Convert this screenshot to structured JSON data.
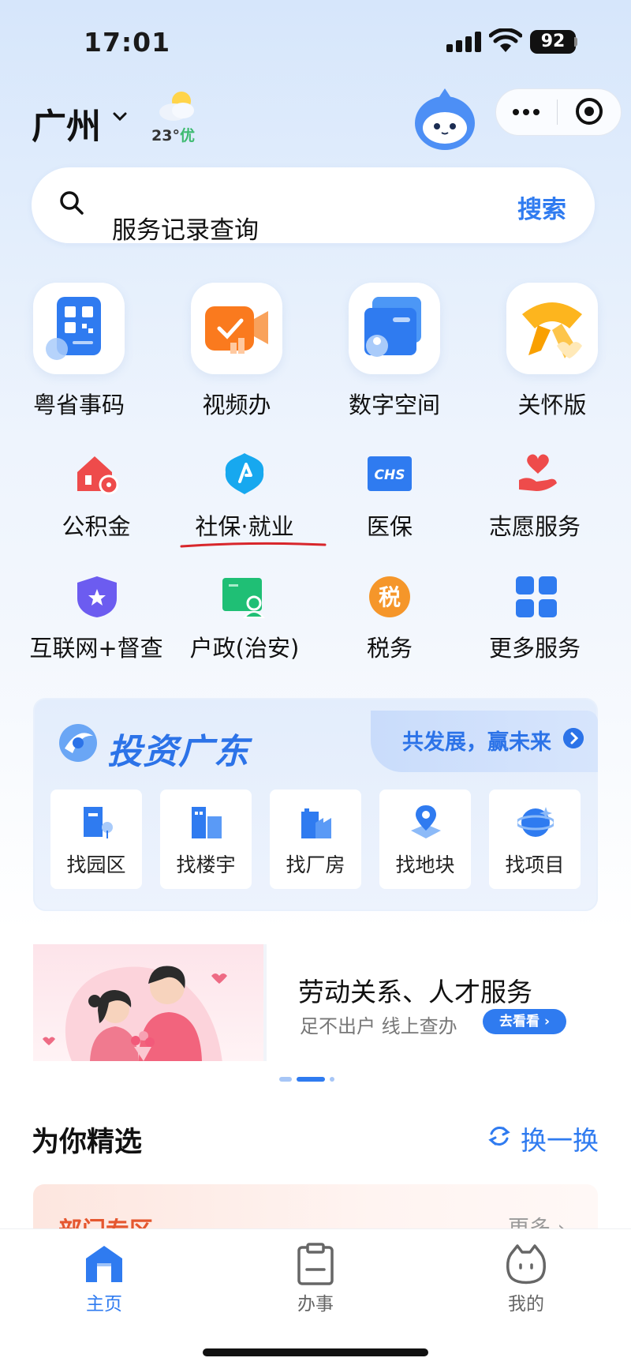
{
  "status_bar": {
    "time": "17:01",
    "battery": "92"
  },
  "header": {
    "city": "广州",
    "weather_temp": "23°",
    "weather_aqi": "优"
  },
  "search": {
    "placeholder": "服务记录查询",
    "button": "搜索"
  },
  "main_services": [
    {
      "label": "粤省事码",
      "icon": "qr-code-icon"
    },
    {
      "label": "视频办",
      "icon": "video-camera-icon"
    },
    {
      "label": "数字空间",
      "icon": "digital-space-icon"
    },
    {
      "label": "关怀版",
      "icon": "care-ribbon-icon"
    }
  ],
  "services": [
    {
      "label": "公积金",
      "icon": "housing-fund-icon"
    },
    {
      "label": "社保·就业",
      "icon": "social-security-icon"
    },
    {
      "label": "医保",
      "icon": "medical-insurance-icon",
      "icon_text": "CHS"
    },
    {
      "label": "志愿服务",
      "icon": "volunteer-heart-icon"
    },
    {
      "label": "互联网+督查",
      "icon": "shield-star-icon"
    },
    {
      "label": "户政(治安)",
      "icon": "household-id-icon"
    },
    {
      "label": "税务",
      "icon": "tax-icon",
      "icon_text": "税"
    },
    {
      "label": "更多服务",
      "icon": "grid-more-icon"
    }
  ],
  "invest": {
    "title": "投资广东",
    "slogan": "共发展，赢未来",
    "items": [
      {
        "label": "找园区",
        "icon": "park-icon"
      },
      {
        "label": "找楼宇",
        "icon": "building-icon"
      },
      {
        "label": "找厂房",
        "icon": "factory-icon"
      },
      {
        "label": "找地块",
        "icon": "land-pin-icon"
      },
      {
        "label": "找项目",
        "icon": "project-icon"
      }
    ]
  },
  "banner": {
    "title": "劳动关系、人才服务",
    "subtitle": "足不出户 线上查办",
    "button": "去看看",
    "button_arrow": "›"
  },
  "picks": {
    "title": "为你精选",
    "refresh": "换一换"
  },
  "dept_card": {
    "title": "部门专区",
    "more": "更多 ›"
  },
  "tabbar": [
    {
      "label": "主页",
      "icon": "home-icon",
      "active": true
    },
    {
      "label": "办事",
      "icon": "clipboard-icon",
      "active": false
    },
    {
      "label": "我的",
      "icon": "profile-face-icon",
      "active": false
    }
  ],
  "colors": {
    "accent": "#2f7bf0",
    "dept_title": "#e5572f"
  }
}
